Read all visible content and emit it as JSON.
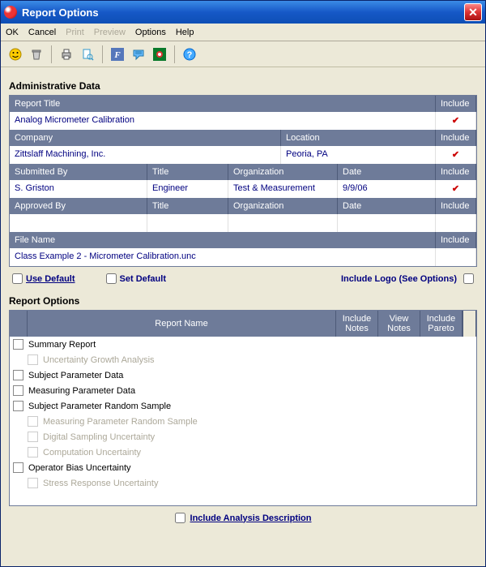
{
  "window": {
    "title": "Report Options",
    "close_label": "✕"
  },
  "menubar": {
    "ok": "OK",
    "cancel": "Cancel",
    "print": "Print",
    "preview": "Preview",
    "options": "Options",
    "help": "Help"
  },
  "admin": {
    "section_title": "Administrative Data",
    "headers": {
      "report_title": "Report Title",
      "include": "Include",
      "company": "Company",
      "location": "Location",
      "submitted_by": "Submitted By",
      "title": "Title",
      "organization": "Organization",
      "date": "Date",
      "approved_by": "Approved By",
      "file_name": "File Name"
    },
    "values": {
      "report_title": "Analog Micrometer Calibration",
      "company": "Zittslaff Machining, Inc.",
      "location": "Peoria, PA",
      "submitted_by": "S. Griston",
      "sub_title": "Engineer",
      "sub_org": "Test & Measurement",
      "sub_date": "9/9/06",
      "approved_by": "",
      "app_title": "",
      "app_org": "",
      "app_date": "",
      "file_name": "Class Example 2 - Micrometer Calibration.unc"
    },
    "check": "✔"
  },
  "defaults": {
    "use_default": "Use Default",
    "set_default": "Set Default",
    "include_logo": "Include Logo (See Options)"
  },
  "report_options": {
    "section_title": "Report Options",
    "headers": {
      "report_name": "Report Name",
      "include_notes": "Include Notes",
      "view_notes": "View Notes",
      "include_pareto": "Include Pareto"
    },
    "items": [
      {
        "label": "Summary Report",
        "enabled": true,
        "indent": 0
      },
      {
        "label": "Uncertainty Growth Analysis",
        "enabled": false,
        "indent": 1
      },
      {
        "label": "Subject Parameter Data",
        "enabled": true,
        "indent": 0
      },
      {
        "label": "Measuring Parameter Data",
        "enabled": true,
        "indent": 0
      },
      {
        "label": "Subject Parameter Random Sample",
        "enabled": true,
        "indent": 0
      },
      {
        "label": "Measuring Parameter Random Sample",
        "enabled": false,
        "indent": 1
      },
      {
        "label": "Digital Sampling Uncertainty",
        "enabled": false,
        "indent": 1
      },
      {
        "label": "Computation Uncertainty",
        "enabled": false,
        "indent": 1
      },
      {
        "label": "Operator Bias Uncertainty",
        "enabled": true,
        "indent": 0
      },
      {
        "label": "Stress Response Uncertainty",
        "enabled": false,
        "indent": 1
      }
    ]
  },
  "bottom": {
    "include_analysis": "Include Analysis Description"
  }
}
